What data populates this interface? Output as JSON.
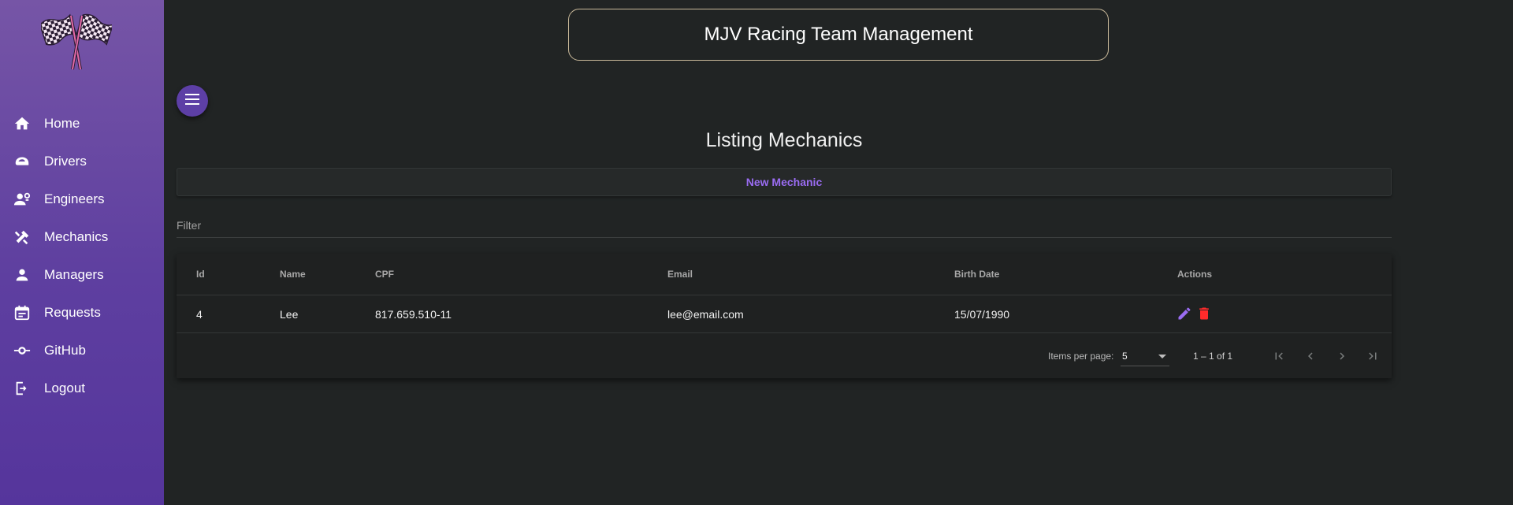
{
  "app": {
    "title": "MJV Racing Team Management"
  },
  "sidebar": {
    "items": [
      {
        "label": "Home",
        "icon": "home-icon"
      },
      {
        "label": "Drivers",
        "icon": "helmet-icon"
      },
      {
        "label": "Engineers",
        "icon": "engineers-icon"
      },
      {
        "label": "Mechanics",
        "icon": "tools-icon"
      },
      {
        "label": "Managers",
        "icon": "person-icon"
      },
      {
        "label": "Requests",
        "icon": "calendar-icon"
      },
      {
        "label": "GitHub",
        "icon": "commit-icon"
      },
      {
        "label": "Logout",
        "icon": "logout-icon"
      }
    ]
  },
  "page": {
    "heading": "Listing Mechanics",
    "new_button": "New Mechanic",
    "filter_placeholder": "Filter"
  },
  "table": {
    "headers": [
      "Id",
      "Name",
      "CPF",
      "Email",
      "Birth Date",
      "Actions"
    ],
    "rows": [
      {
        "id": "4",
        "name": "Lee",
        "cpf": "817.659.510-11",
        "email": "lee@email.com",
        "birth_date": "15/07/1990"
      }
    ]
  },
  "paginator": {
    "items_per_page_label": "Items per page:",
    "items_per_page_value": "5",
    "range_label": "1 – 1 of 1"
  },
  "colors": {
    "sidebar": "#6a4aa3",
    "accent": "#9a6cf2",
    "edit": "#9a6cf2",
    "delete": "#ff2b2b"
  }
}
